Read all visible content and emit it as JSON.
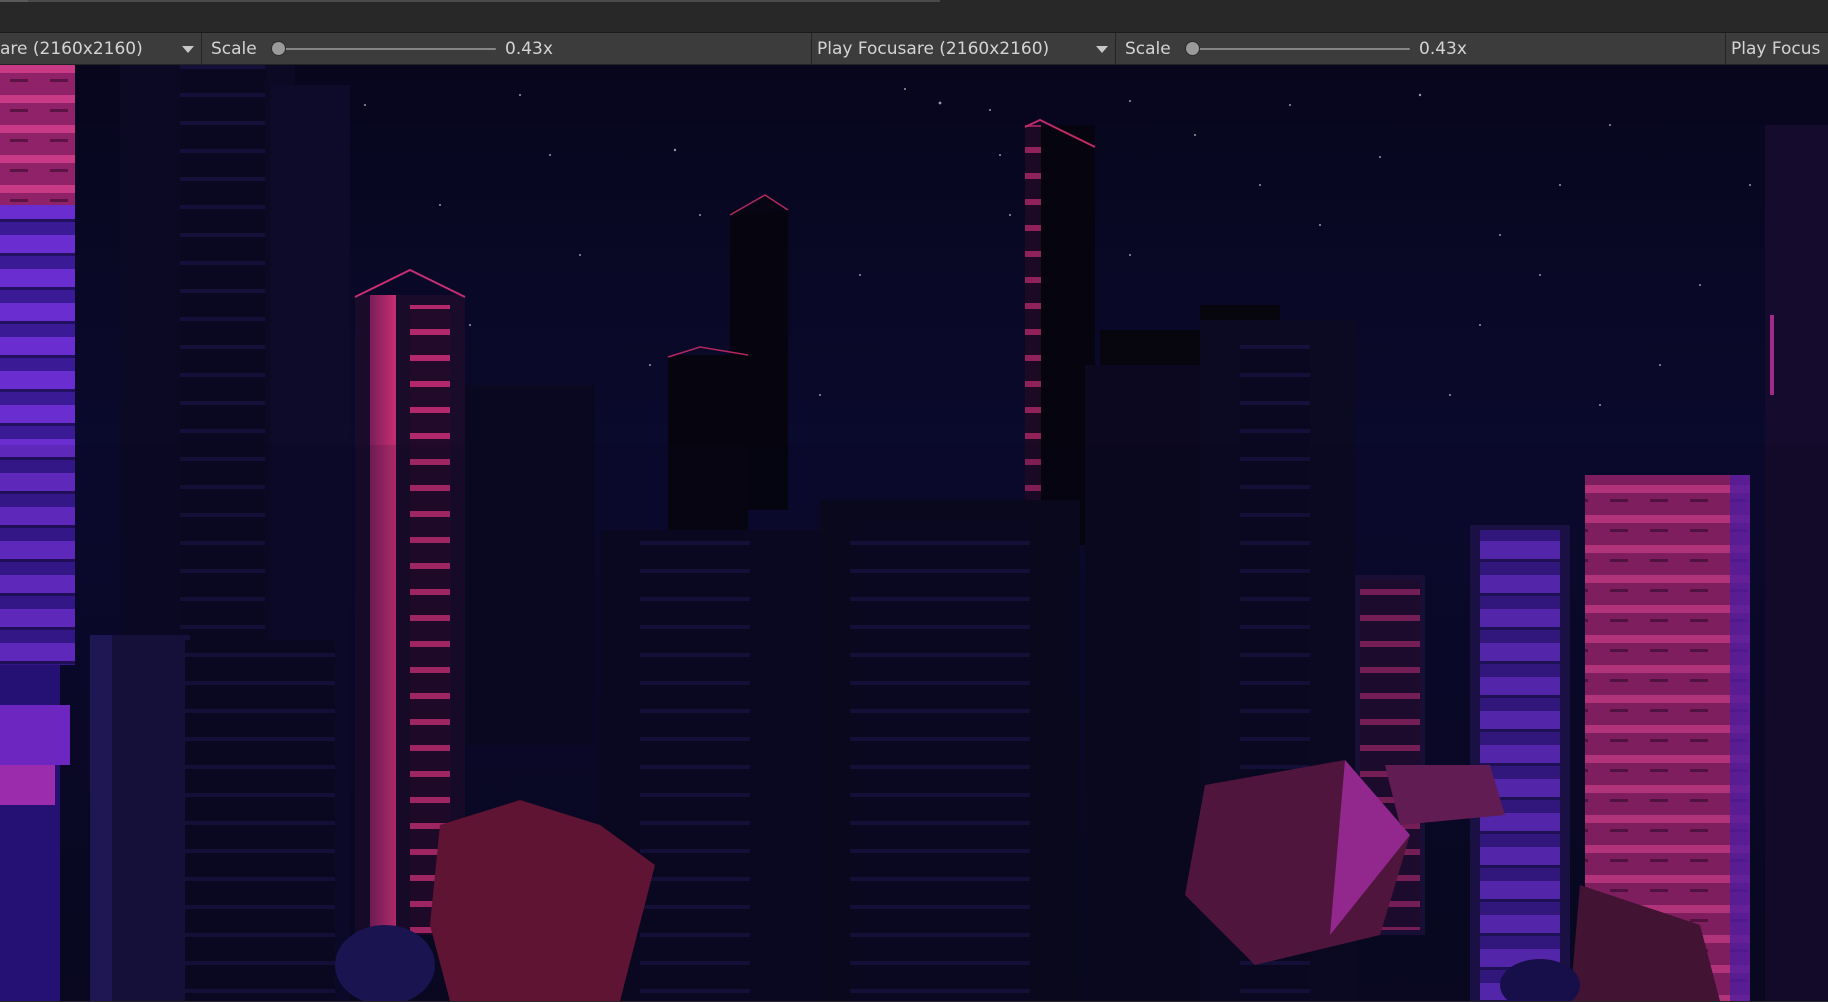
{
  "toolbar": {
    "left_view": {
      "resolution_label": "are (2160x2160)",
      "scale_label": "Scale",
      "scale_value": "0.43x",
      "scale_fraction": 0.0
    },
    "middle_view": {
      "resolution_label": "Play Focusare (2160x2160)",
      "scale_label": "Scale",
      "scale_value": "0.43x",
      "scale_fraction": 0.0
    },
    "right_view": {
      "resolution_label": "Play Focus"
    }
  },
  "scene": {
    "description_icon": "city-night-scene",
    "sky_color": "#07061a",
    "accent_colors": [
      "#c02a66",
      "#7a2bd6",
      "#a532a8"
    ]
  }
}
